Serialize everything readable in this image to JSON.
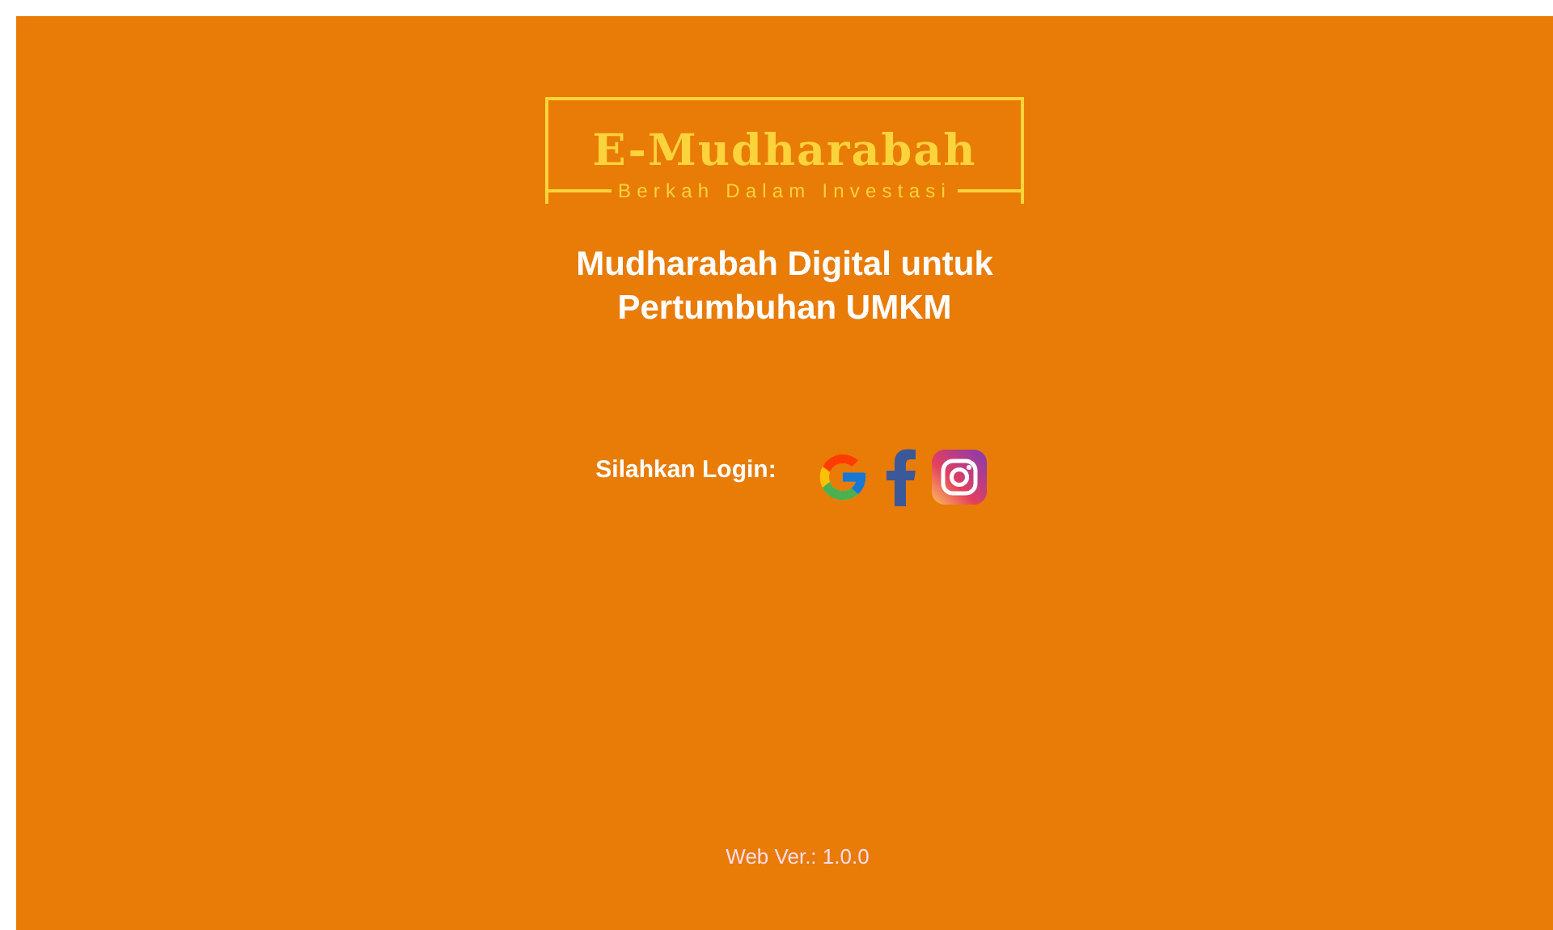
{
  "logo": {
    "title": "E-Mudharabah",
    "tagline": "Berkah Dalam Investasi"
  },
  "headline": [
    "Mudharabah Digital untuk",
    "Pertumbuhan UMKM"
  ],
  "login": {
    "label": "Silahkan Login:",
    "providers": [
      {
        "kind": "google"
      },
      {
        "kind": "facebook"
      },
      {
        "kind": "instagram"
      }
    ]
  },
  "footer": {
    "version": "Web Ver.: 1.0.0"
  }
}
